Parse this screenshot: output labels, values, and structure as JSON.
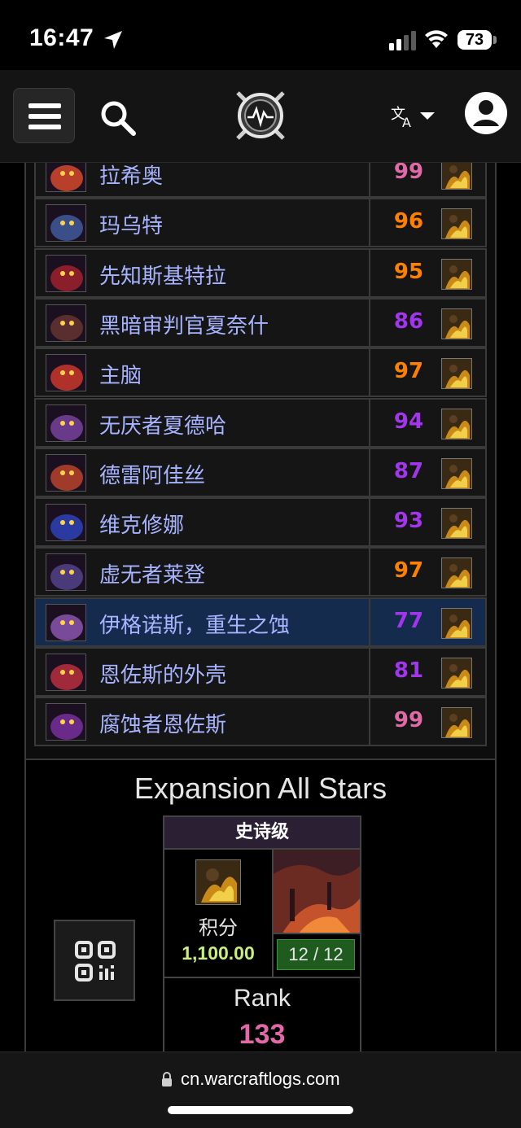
{
  "status": {
    "time": "16:47",
    "battery": "73"
  },
  "navbar": {
    "icons": [
      "menu-icon",
      "search-icon",
      "warcraftlogs-logo",
      "language-icon",
      "account-icon"
    ]
  },
  "encounters": [
    {
      "name": "拉希奥",
      "score": "99",
      "color": "#e268a8",
      "icon": "boss-rasheo-icon"
    },
    {
      "name": "玛乌特",
      "score": "96",
      "color": "#ff8000",
      "icon": "boss-mawrat-icon"
    },
    {
      "name": "先知斯基特拉",
      "score": "95",
      "color": "#ff8000",
      "icon": "boss-skitra-icon"
    },
    {
      "name": "黑暗审判官夏奈什",
      "score": "86",
      "color": "#a335ee",
      "icon": "boss-xanesh-icon"
    },
    {
      "name": "主脑",
      "score": "97",
      "color": "#ff8000",
      "icon": "boss-hivemind-icon"
    },
    {
      "name": "无厌者夏德哈",
      "score": "94",
      "color": "#a335ee",
      "icon": "boss-shadhar-icon"
    },
    {
      "name": "德雷阿佳丝",
      "score": "87",
      "color": "#a335ee",
      "icon": "boss-drestagath-icon"
    },
    {
      "name": "维克修娜",
      "score": "93",
      "color": "#a335ee",
      "icon": "boss-vexiona-icon"
    },
    {
      "name": "虚无者莱登",
      "score": "97",
      "color": "#ff8000",
      "icon": "boss-raden-icon"
    },
    {
      "name": "伊格诺斯，重生之蚀",
      "score": "77",
      "color": "#a335ee",
      "icon": "boss-ilgynoth-icon",
      "selected": true
    },
    {
      "name": "恩佐斯的外壳",
      "score": "81",
      "color": "#a335ee",
      "icon": "boss-carapace-icon"
    },
    {
      "name": "腐蚀者恩佐斯",
      "score": "99",
      "color": "#e268a8",
      "icon": "boss-nzoth-icon"
    }
  ],
  "allstars": {
    "title": "Expansion All Stars",
    "difficulty": "史诗级",
    "points_label": "积分",
    "points_value": "1,100.00",
    "progress": "12 / 12",
    "rank_label": "Rank",
    "rank_value": "133",
    "rank_color": "#e268a8"
  },
  "browser": {
    "url": "cn.warcraftlogs.com"
  }
}
